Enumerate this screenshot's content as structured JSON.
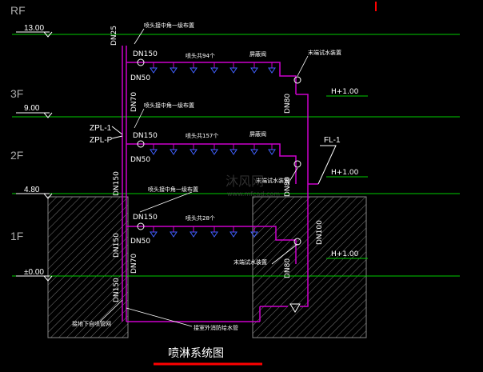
{
  "floors": [
    {
      "name": "RF",
      "elevation": "13.00"
    },
    {
      "name": "3F",
      "elevation": "9.00"
    },
    {
      "name": "2F",
      "elevation": "4.80"
    },
    {
      "name": "1F",
      "elevation": "±0.00"
    }
  ],
  "title": "喷淋系统图",
  "riser_labels": [
    "ZPL-1",
    "ZPL-P"
  ],
  "fl_label": "FL-1",
  "pipe_sizes": {
    "dn25": "DN25",
    "dn150_3f": "DN150",
    "dn50_3f": "DN50",
    "dn70_a": "DN70",
    "dn150_2f": "DN150",
    "dn50_2f": "DN50",
    "dn150_riser": "DN150",
    "dn150_1f": "DN150",
    "dn50_1f": "DN50",
    "dn150_lower": "DN150",
    "dn70_lower": "DN70",
    "dn150_bottom": "DN150",
    "dn80_3f": "DN80",
    "dn80_2f": "DN80",
    "dn80_1f": "DN80",
    "dn100": "DN100"
  },
  "heads": {
    "rf": "喷头共94个",
    "f3": "喷头共157个",
    "f2": "喷头共28个"
  },
  "notes": {
    "valve_rf": "喷头接中角一级布置",
    "valve_3f": "喷头接中角一级布置",
    "valve_2f": "喷头接中角一级布置",
    "damper_rf": "屏蔽阀",
    "damper_3f": "屏蔽阀",
    "end_rf": "末端试水装置",
    "end_3f": "末端试水装置",
    "end_2f": "末端试水装置",
    "bottom_left": "接地下自喷管网",
    "bottom_mid": "接室外消防给水管"
  },
  "level_marks": {
    "h_rf": "H+1.00",
    "h_3f": "H+1.00",
    "h_2f": "H+1.00"
  },
  "watermark": {
    "main": "沐风网",
    "sub": "www.mfcad.com"
  },
  "colors": {
    "pipe": "#cc00cc",
    "line": "#00cc00",
    "accent": "#ff0000",
    "bg": "#000000"
  }
}
